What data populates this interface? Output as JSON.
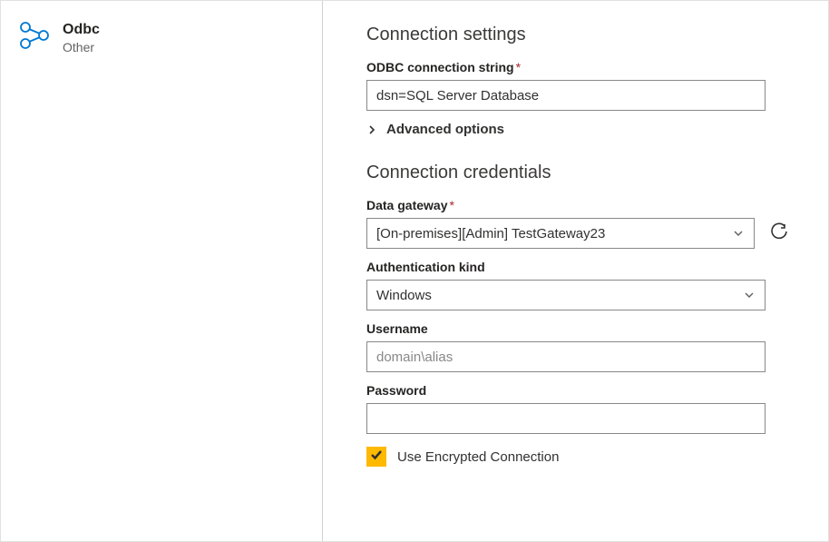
{
  "left": {
    "title": "Odbc",
    "subtitle": "Other",
    "icon": "odbc-icon",
    "iconColor": "#0078d4"
  },
  "settings": {
    "heading": "Connection settings",
    "connectionString": {
      "label": "ODBC connection string",
      "required": true,
      "value": "dsn=SQL Server Database"
    },
    "advancedLabel": "Advanced options"
  },
  "credentials": {
    "heading": "Connection credentials",
    "gateway": {
      "label": "Data gateway",
      "required": true,
      "value": "[On-premises][Admin] TestGateway23"
    },
    "authKind": {
      "label": "Authentication kind",
      "value": "Windows"
    },
    "username": {
      "label": "Username",
      "placeholder": "domain\\alias",
      "value": ""
    },
    "password": {
      "label": "Password",
      "value": ""
    },
    "encrypted": {
      "label": "Use Encrypted Connection",
      "checked": true
    }
  },
  "colors": {
    "accent": "#ffb900",
    "danger": "#a4262c"
  }
}
